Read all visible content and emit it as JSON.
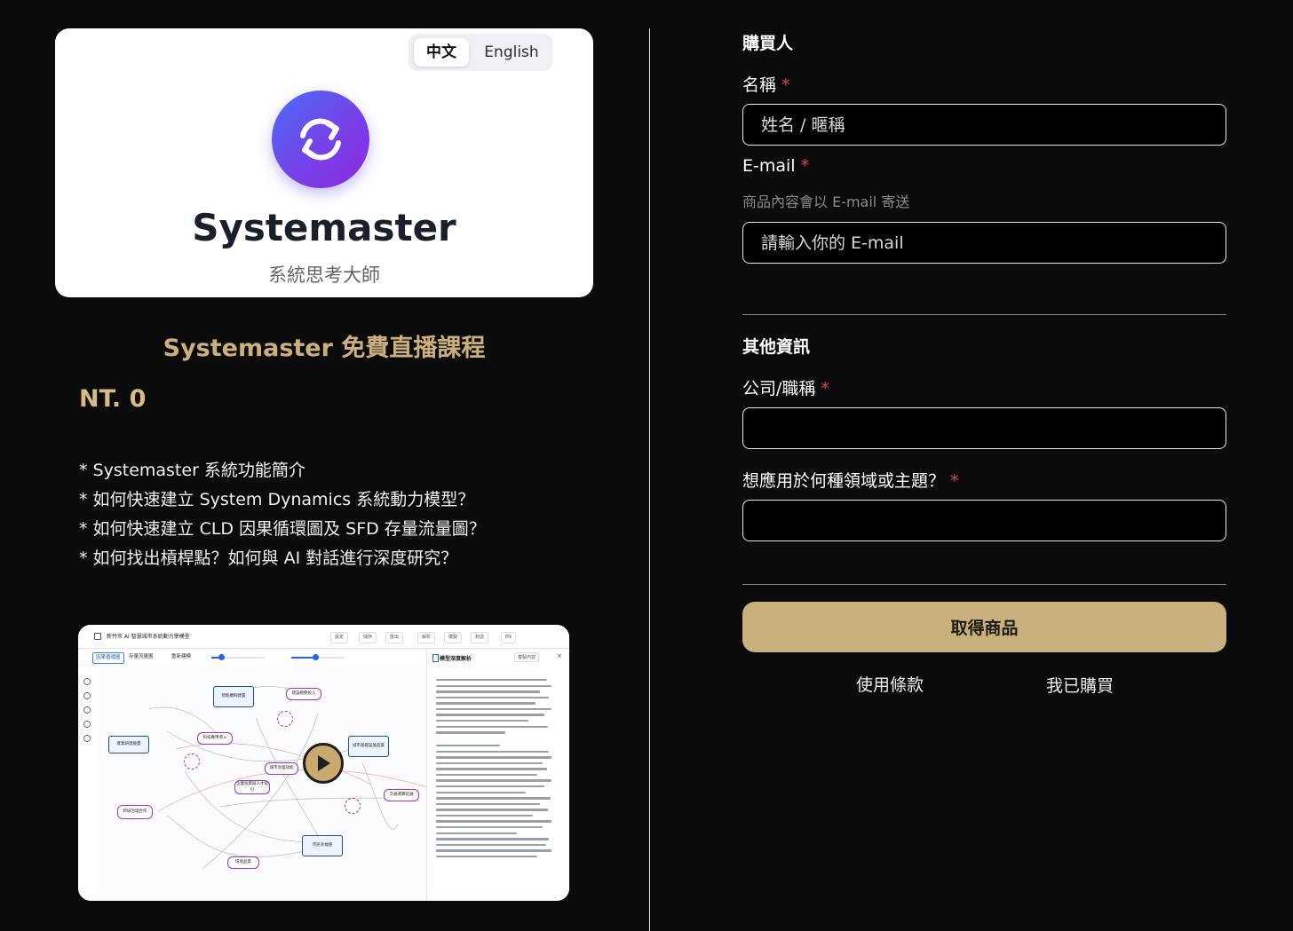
{
  "product": {
    "lang_zh": "中文",
    "lang_en": "English",
    "logo_icon": "sync-arrows-icon",
    "brand_name": "Systemaster",
    "brand_sub": "系統思考大師",
    "course_title": "Systemaster 免費直播課程",
    "price": "NT. 0",
    "features": [
      "* Systemaster 系統功能簡介",
      "* 如何快速建立 System Dynamics 系統動力模型？",
      "* 如何快速建立 CLD 因果循環圖及 SFD 存量流量圖？",
      "* 如何找出槓桿點？如何與 AI 對話進行深度研究？"
    ],
    "video": {
      "title": "新竹市 AI 智慧城市系統動力學模型",
      "tools": [
        "設定",
        "儲存",
        "匯出",
        "解析",
        "模擬",
        "對話",
        "EN"
      ],
      "tabs": [
        "因果循環圖",
        "存量流量圖",
        "重新建模"
      ],
      "panel_title": "模型深度解析",
      "panel_button": "複製內容",
      "nodes": [
        "智能機制建置",
        "建設規劃投入",
        "產業研發能量",
        "科技應用導入",
        "城市基礎設施品質",
        "城市治理效能",
        "企業投資與人才吸引",
        "交通運算延展",
        "跨域治理合作",
        "市民幸福感",
        "環境品質"
      ],
      "play_icon": "play-icon"
    }
  },
  "form": {
    "buyer_title": "購買人",
    "name_label": "名稱",
    "name_placeholder": "姓名 / 暱稱",
    "email_label": "E-mail",
    "email_hint": "商品內容會以 E-mail 寄送",
    "email_placeholder": "請輸入你的 E-mail",
    "other_title": "其他資訊",
    "company_label": "公司/職稱",
    "domain_label": "想應用於何種領域或主題？",
    "required_mark": "*",
    "submit_label": "取得商品",
    "terms_link": "使用條款",
    "purchased_link": "我已購買"
  }
}
